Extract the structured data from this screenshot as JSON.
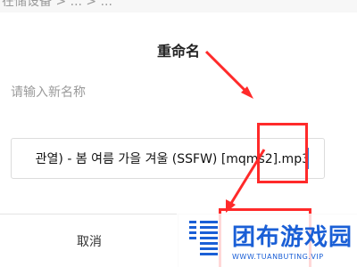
{
  "top_partial_text": "在储设备 > ... > ...",
  "dialog": {
    "title": "重命名",
    "hint": "请输入新名称",
    "filename_value": "관열) - 봄 여름 가을 겨울 (SSFW) [mqms2].mp3",
    "cancel_label": "取消",
    "ok_label": ""
  },
  "watermark": {
    "brand": "团布游戏园",
    "url": "WWW.TUANBUTING.VIP",
    "color": "#1a5fd6"
  },
  "annotation_color": "#ff2a2a"
}
